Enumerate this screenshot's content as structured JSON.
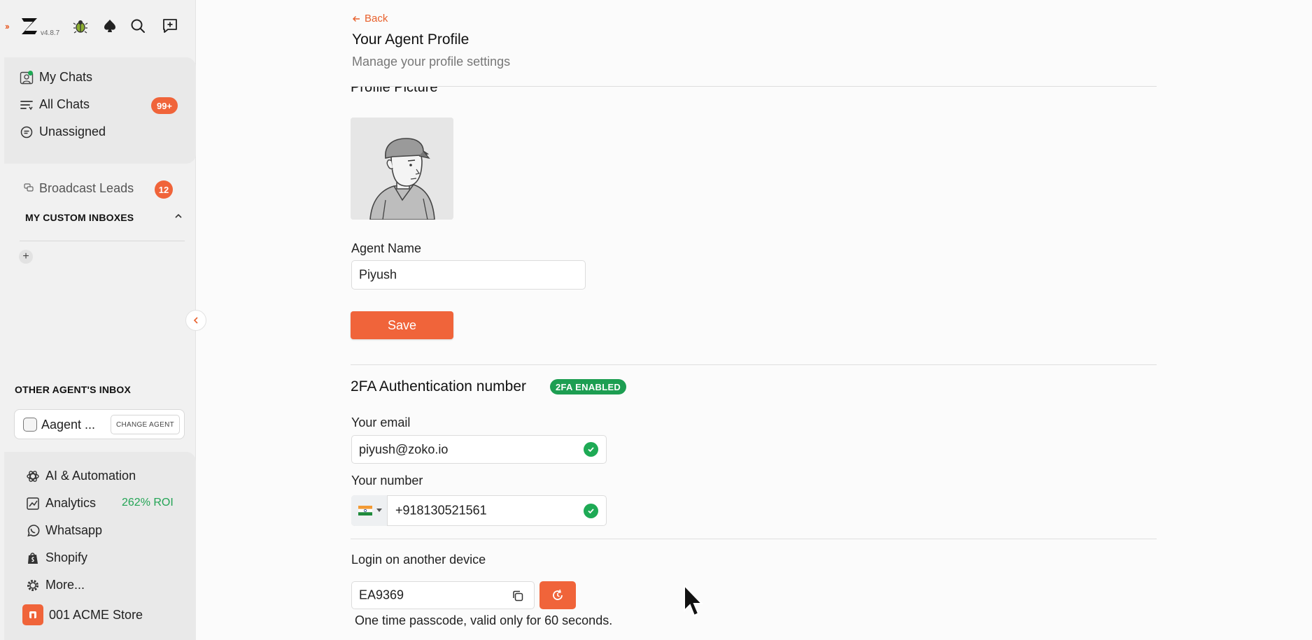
{
  "app": {
    "version": "v4.8.7"
  },
  "sidebar": {
    "primary": [
      {
        "label": "My Chats",
        "icon": "person-board-icon"
      },
      {
        "label": "All Chats",
        "icon": "filter-lines-icon",
        "badge": "99+"
      },
      {
        "label": "Unassigned",
        "icon": "chat-bubble-icon"
      }
    ],
    "broadcast": {
      "label": "Broadcast Leads",
      "badge": "12"
    },
    "custom_inboxes_title": "MY CUSTOM INBOXES",
    "other_agents_title": "OTHER AGENT'S INBOX",
    "agent": {
      "name": "Aagent ...",
      "change_label": "CHANGE AGENT"
    },
    "bottom": [
      {
        "label": "AI & Automation",
        "icon": "openai-icon"
      },
      {
        "label": "Analytics",
        "icon": "analytics-chart-icon",
        "extra": "262% ROI"
      },
      {
        "label": "Whatsapp",
        "icon": "whatsapp-icon"
      },
      {
        "label": "Shopify",
        "icon": "shopify-bag-icon"
      },
      {
        "label": "More...",
        "icon": "gear-icon"
      }
    ],
    "store": {
      "label": "001 ACME Store"
    }
  },
  "header": {
    "back": "Back",
    "title": "Your Agent Profile",
    "subtitle": "Manage your profile settings"
  },
  "profile": {
    "picture_title": "Profile Picture",
    "agent_name_label": "Agent Name",
    "agent_name_value": "Piyush",
    "save_label": "Save"
  },
  "twofa": {
    "title": "2FA Authentication number",
    "badge": "2FA ENABLED",
    "email_label": "Your email",
    "email_value": "piyush@zoko.io",
    "number_label": "Your number",
    "number_value": "+918130521561",
    "country": "India"
  },
  "login": {
    "title": "Login on another device",
    "code": "EA9369",
    "hint": "One time passcode, valid only for 60 seconds."
  },
  "colors": {
    "accent": "#f0643a",
    "success": "#1d9e52",
    "online": "#1eaa55"
  }
}
